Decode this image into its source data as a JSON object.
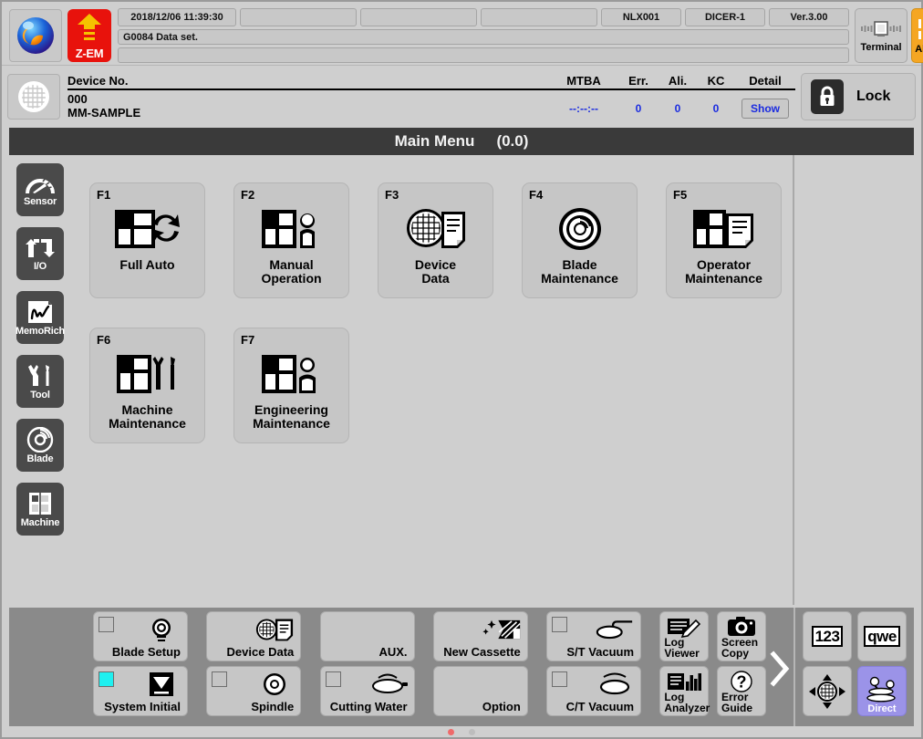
{
  "topbar": {
    "logo_icon": "zem-sphere-logo",
    "zem": {
      "label": "Z-EM",
      "icon": "up-arrow-icon",
      "color": "#e8120c"
    },
    "fields": [
      {
        "name": "datetime",
        "value": "2018/12/06 11:39:30"
      },
      {
        "name": "field-2",
        "value": ""
      },
      {
        "name": "field-3",
        "value": ""
      },
      {
        "name": "field-4",
        "value": ""
      },
      {
        "name": "machine-id",
        "value": "NLX001"
      },
      {
        "name": "model",
        "value": "DICER-1"
      },
      {
        "name": "version",
        "value": "Ver.3.00"
      }
    ],
    "message_line_1": "G0084  Data set.",
    "message_line_2": "",
    "terminal": {
      "label": "Terminal",
      "icon": "terminal-icon"
    },
    "alarm": {
      "label": "Alarm/Clr",
      "icon": "alarm-waveform-icon",
      "color": "#f5a623"
    }
  },
  "device": {
    "icon": "wafer-icon",
    "title": "Device No.",
    "number": "000",
    "name": "MM-SAMPLE",
    "columns": [
      "MTBA",
      "Err.",
      "Ali.",
      "KC",
      "Detail"
    ],
    "values": {
      "mtba": "--:--:--",
      "err": "0",
      "ali": "0",
      "kc": "0"
    },
    "detail_button": "Show",
    "value_color": "#1a2be0",
    "lock": {
      "label": "Lock",
      "icon": "padlock-icon"
    }
  },
  "title": {
    "text": "Main Menu",
    "page": "(0.0)"
  },
  "sidebar": {
    "items": [
      {
        "label": "Sensor",
        "icon": "gauge-icon"
      },
      {
        "label": "I/O",
        "icon": "io-arrows-icon"
      },
      {
        "label": "MemoRich",
        "icon": "memorich-icon"
      },
      {
        "label": "Tool",
        "icon": "wrench-screwdriver-icon"
      },
      {
        "label": "Blade",
        "icon": "blade-disc-icon"
      },
      {
        "label": "Machine",
        "icon": "machine-panel-icon"
      }
    ]
  },
  "menu": {
    "row1": [
      {
        "key": "F1",
        "label": "Full Auto",
        "icon": "full-auto-icon"
      },
      {
        "key": "F2",
        "label": "Manual\nOperation",
        "icon": "manual-operation-icon"
      },
      {
        "key": "F3",
        "label": "Device\nData",
        "icon": "device-data-icon"
      },
      {
        "key": "F4",
        "label": "Blade\nMaintenance",
        "icon": "blade-maintenance-icon"
      },
      {
        "key": "F5",
        "label": "Operator\nMaintenance",
        "icon": "operator-maintenance-icon"
      }
    ],
    "row2": [
      {
        "key": "F6",
        "label": "Machine\nMaintenance",
        "icon": "machine-maintenance-icon"
      },
      {
        "key": "F7",
        "label": "Engineering\nMaintenance",
        "icon": "engineering-maintenance-icon"
      }
    ]
  },
  "toolbar": {
    "buttons": [
      {
        "label": "Blade Setup",
        "icon": "blade-setup-icon",
        "checkbox": "off",
        "size": "wide"
      },
      {
        "label": "System Initial",
        "icon": "funnel-icon",
        "checkbox": "on",
        "size": "wide"
      },
      {
        "label": "Device Data",
        "icon": "device-data-icon",
        "checkbox": "none",
        "size": "wide"
      },
      {
        "label": "Spindle",
        "icon": "spindle-icon",
        "checkbox": "off",
        "size": "wide"
      },
      {
        "label": "AUX.",
        "icon": "none",
        "checkbox": "none",
        "size": "wide"
      },
      {
        "label": "Cutting Water",
        "icon": "water-nozzle-icon",
        "checkbox": "off",
        "size": "wide"
      },
      {
        "label": "New Cassette",
        "icon": "new-cassette-icon",
        "checkbox": "none",
        "size": "wide"
      },
      {
        "label": "Option",
        "icon": "none",
        "checkbox": "none",
        "size": "wide"
      },
      {
        "label": "S/T Vacuum",
        "icon": "st-vacuum-icon",
        "checkbox": "off",
        "size": "wide"
      },
      {
        "label": "C/T Vacuum",
        "icon": "ct-vacuum-icon",
        "checkbox": "off",
        "size": "wide"
      },
      {
        "label": "Log\nViewer",
        "icon": "log-viewer-icon",
        "checkbox": "none",
        "size": "small"
      },
      {
        "label": "Log\nAnalyzer",
        "icon": "log-analyzer-icon",
        "checkbox": "none",
        "size": "small"
      },
      {
        "label": "Screen\nCopy",
        "icon": "camera-icon",
        "checkbox": "none",
        "size": "small"
      },
      {
        "label": "Error\nGuide",
        "icon": "question-mark-icon",
        "checkbox": "none",
        "size": "small"
      }
    ],
    "next_page_icon": "chevron-right-icon",
    "keypad": [
      {
        "label": "123",
        "icon": "numeric-keypad-icon"
      },
      {
        "label": "qwe",
        "icon": "qwerty-keyboard-icon"
      },
      {
        "label": "",
        "icon": "wafer-dpad-icon"
      },
      {
        "label": "Direct",
        "icon": "direct-icon",
        "color": "#9b93e8"
      }
    ],
    "page_dots": {
      "count": 2,
      "active_index": 0,
      "active_color": "#ef6a6a"
    }
  }
}
